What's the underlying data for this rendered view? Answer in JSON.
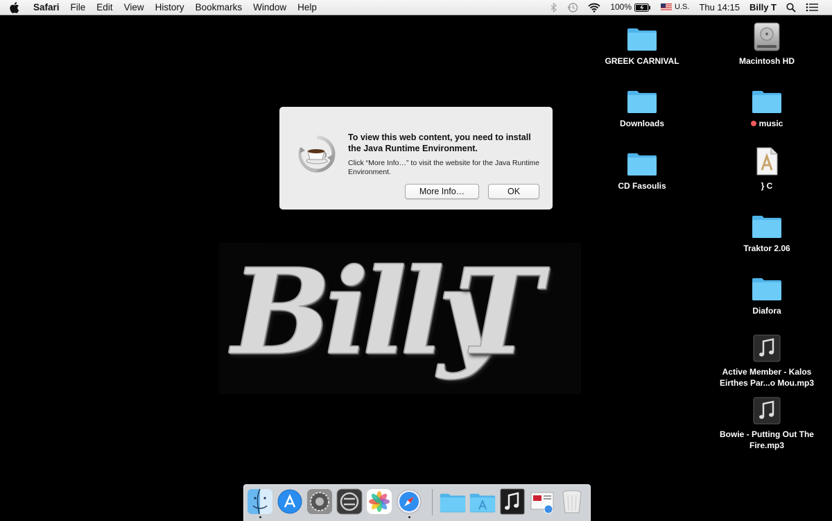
{
  "menubar": {
    "app": "Safari",
    "menus": [
      "File",
      "Edit",
      "View",
      "History",
      "Bookmarks",
      "Window",
      "Help"
    ],
    "battery": "100%",
    "input_source": "U.S.",
    "clock": "Thu 14:15",
    "user": "Billy T",
    "icons": [
      "apple-icon",
      "bluetooth-icon",
      "time-machine-icon",
      "wifi-icon",
      "battery-icon",
      "flag-icon",
      "spotlight-icon",
      "notification-center-icon"
    ]
  },
  "dialog": {
    "title": "To view this web content, you need to install the Java Runtime Environment.",
    "body": "Click “More Info…” to visit the website for the Java Runtime Environment.",
    "more_info_label": "More Info…",
    "ok_label": "OK",
    "icon": "java-coffee-icon"
  },
  "wallpaper": {
    "text_billy": "Billy",
    "text_t": "T"
  },
  "desktop": {
    "col_left": [
      {
        "label": "GREEK CARNIVAL",
        "icon": "folder-icon"
      },
      {
        "label": "Downloads",
        "icon": "folder-icon"
      },
      {
        "label": "CD Fasoulis",
        "icon": "folder-icon"
      }
    ],
    "col_right": [
      {
        "label": "Macintosh HD",
        "icon": "hard-drive-icon"
      },
      {
        "label": "music",
        "icon": "folder-icon",
        "tag_color": "#f35a5a"
      },
      {
        "label": "} C",
        "icon": "document-icon"
      },
      {
        "label": "Traktor 2.06",
        "icon": "folder-icon"
      },
      {
        "label": "Diafora",
        "icon": "folder-icon"
      },
      {
        "label": "Active Member - Kalos Eirthes Par...o Mou.mp3",
        "icon": "music-file-icon"
      },
      {
        "label": "Bowie - Putting Out The Fire.mp3",
        "icon": "music-file-icon"
      }
    ]
  },
  "dock": {
    "items": [
      "finder-icon",
      "app-store-icon",
      "system-preferences-icon",
      "boot-camp-icon",
      "photos-icon",
      "safari-icon",
      "folder-icon",
      "applications-folder-icon",
      "music-file-icon",
      "preview-icon",
      "trash-icon"
    ],
    "running": [
      "finder-icon",
      "safari-icon"
    ]
  },
  "colors": {
    "folder": "#5ec3f5",
    "desktop_bg": "#000000",
    "dialog_bg": "#ececec"
  }
}
